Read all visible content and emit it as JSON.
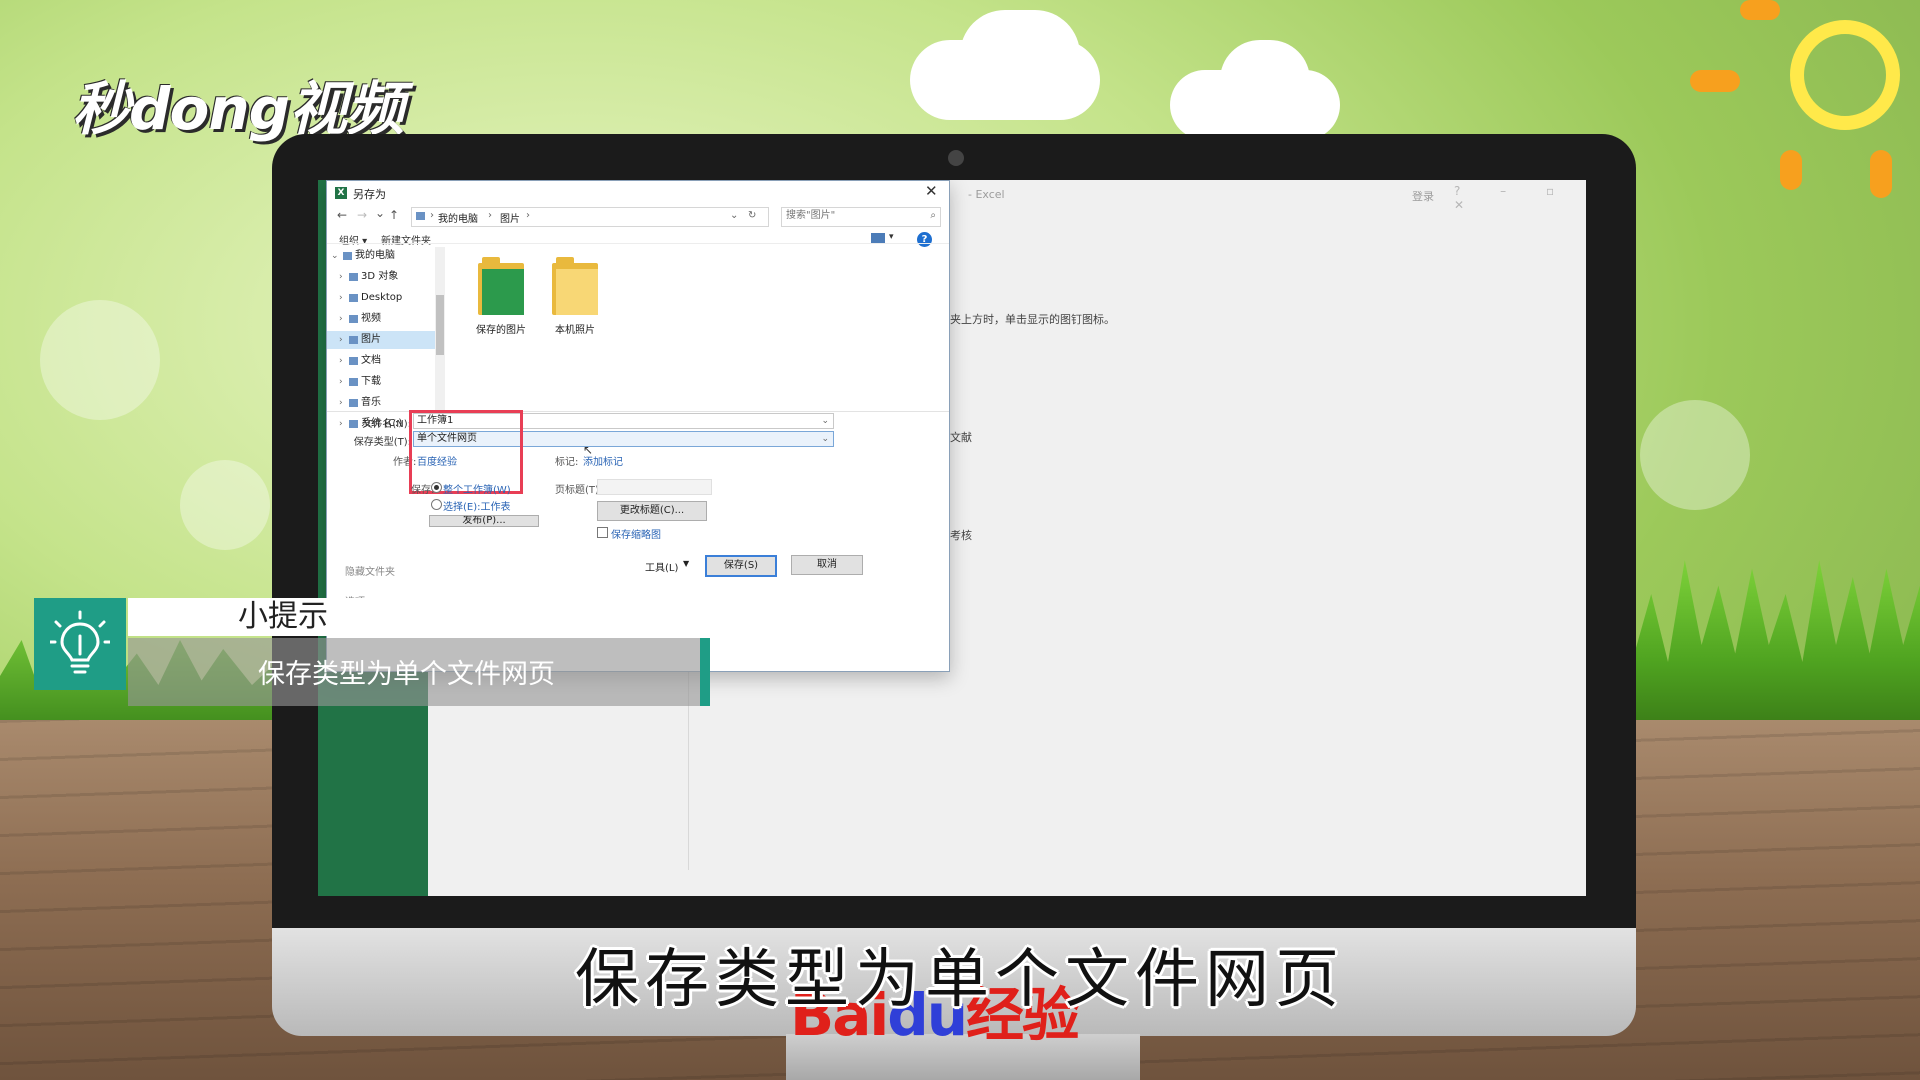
{
  "brand": {
    "logo_text": "秒dong视频",
    "watermark_bai": "Bai",
    "watermark_du": "du",
    "watermark_jingyan": "经验"
  },
  "excel": {
    "title": "- Excel",
    "login": "登录",
    "controls": "? – ▫ ✕",
    "hint_1": "夹上方时，单击显示的图钉图标。",
    "hint_2": "文献",
    "hint_3": "考核"
  },
  "dialog": {
    "title": "另存为",
    "nav": {
      "back": "←",
      "forward": "→",
      "recent": "⌄",
      "up": "↑"
    },
    "address": {
      "root": "我的电脑",
      "current": "图片",
      "sep": "›"
    },
    "search": {
      "placeholder": "搜索\"图片\""
    },
    "toolbar": {
      "organize": "组织 ▾",
      "new_folder": "新建文件夹",
      "help": "?"
    },
    "tree": [
      {
        "label": "我的电脑",
        "expanded": true
      },
      {
        "label": "3D 对象"
      },
      {
        "label": "Desktop"
      },
      {
        "label": "视频"
      },
      {
        "label": "图片",
        "selected": true
      },
      {
        "label": "文档"
      },
      {
        "label": "下载"
      },
      {
        "label": "音乐"
      },
      {
        "label": "系统 (C:)"
      }
    ],
    "folders": [
      {
        "label": "保存的图片",
        "variant": "green"
      },
      {
        "label": "本机照片",
        "variant": "yellow"
      }
    ],
    "filename": {
      "label": "文件名(N):",
      "value": "工作簿1"
    },
    "filetype": {
      "label": "保存类型(T):",
      "value": "单个文件网页"
    },
    "author": {
      "label": "作者:",
      "value": "百度经验"
    },
    "tags": {
      "label": "标记:",
      "value": "添加标记"
    },
    "save_scope": {
      "label": "保存:",
      "option_workbook": "整个工作簿(W)",
      "option_sheet": "选择(E):工作表",
      "selected": "workbook"
    },
    "publish_button": "发布(P)...",
    "page_title": {
      "label": "页标题(T):",
      "value": ""
    },
    "change_title_button": "更改标题(C)...",
    "thumbnail": {
      "label": "保存缩略图",
      "checked": false
    },
    "hide_folders": "隐藏文件夹",
    "tools_button": "工具(L)",
    "save_button": "保存(S)",
    "cancel_button": "取消",
    "options_label": "选项"
  },
  "tip": {
    "heading": "小提示",
    "body": "保存类型为单个文件网页"
  },
  "subtitle": "保存类型为单个文件网页",
  "colors": {
    "accent_teal": "#1f9d86",
    "excel_green": "#217346",
    "highlight_red": "#e83e55",
    "link_blue": "#2a64b5"
  }
}
